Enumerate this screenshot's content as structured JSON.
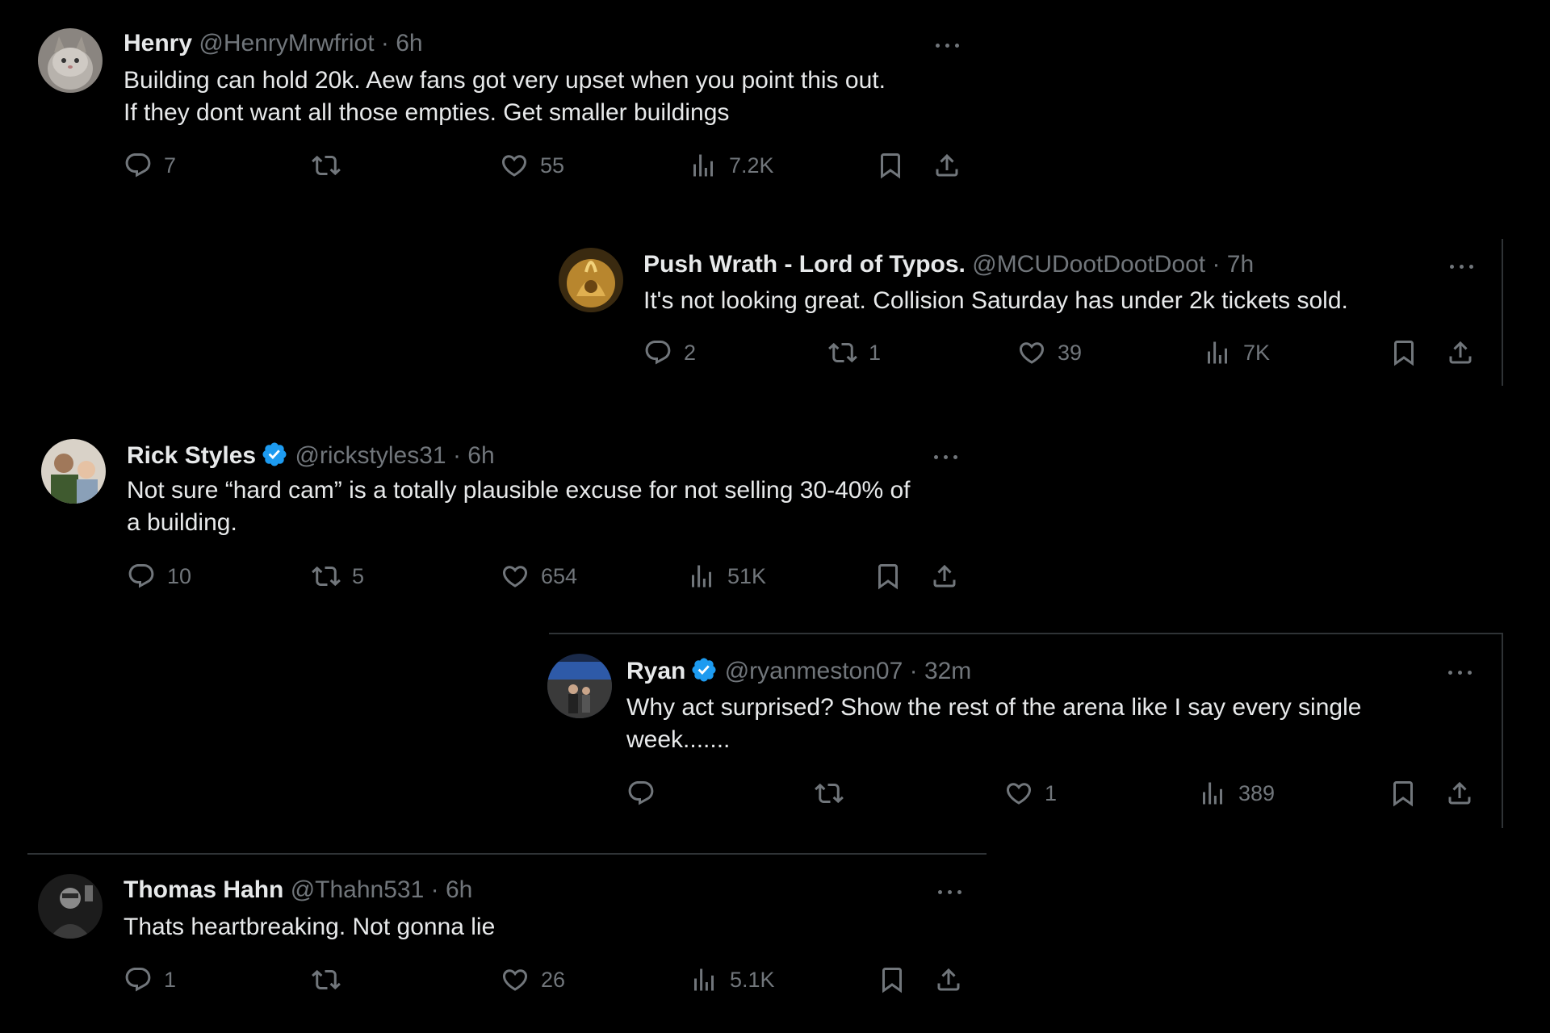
{
  "tweets": [
    {
      "name": "Henry",
      "handle": "@HenryMrwfriot",
      "sep": "·",
      "time": "6h",
      "verified": false,
      "text": "Building can hold 20k.   Aew fans got very upset when you point this out.\nIf they dont want all those empties. Get smaller buildings",
      "replies": "7",
      "retweets": "",
      "likes": "55",
      "views": "7.2K"
    },
    {
      "name": "Push Wrath - Lord of Typos.",
      "handle": "@MCUDootDootDoot",
      "sep": "·",
      "time": "7h",
      "verified": false,
      "text": "It's not looking great. Collision Saturday has under 2k tickets sold.",
      "replies": "2",
      "retweets": "1",
      "likes": "39",
      "views": "7K"
    },
    {
      "name": "Rick Styles",
      "handle": "@rickstyles31",
      "sep": "·",
      "time": "6h",
      "verified": true,
      "text": "Not sure “hard cam” is a totally plausible excuse for not selling 30-40% of\na building.",
      "replies": "10",
      "retweets": "5",
      "likes": "654",
      "views": "51K"
    },
    {
      "name": "Ryan",
      "handle": "@ryanmeston07",
      "sep": "·",
      "time": "32m",
      "verified": true,
      "text": "Why act surprised?  Show the rest of the arena like I say every single\nweek.......",
      "replies": "",
      "retweets": "",
      "likes": "1",
      "views": "389"
    },
    {
      "name": "Thomas Hahn",
      "handle": "@Thahn531",
      "sep": "·",
      "time": "6h",
      "verified": false,
      "text": "Thats heartbreaking. Not gonna lie",
      "replies": "1",
      "retweets": "",
      "likes": "26",
      "views": "5.1K"
    }
  ],
  "icons": {
    "reply": "reply-icon",
    "retweet": "retweet-icon",
    "like": "heart-icon",
    "views": "views-icon",
    "bookmark": "bookmark-icon",
    "share": "share-icon",
    "more": "more-icon",
    "verified": "verified-badge-icon"
  },
  "colors": {
    "background": "#000000",
    "text": "#e7e9ea",
    "muted": "#71767b",
    "verified": "#1d9bf0",
    "divider": "#2f3336"
  }
}
